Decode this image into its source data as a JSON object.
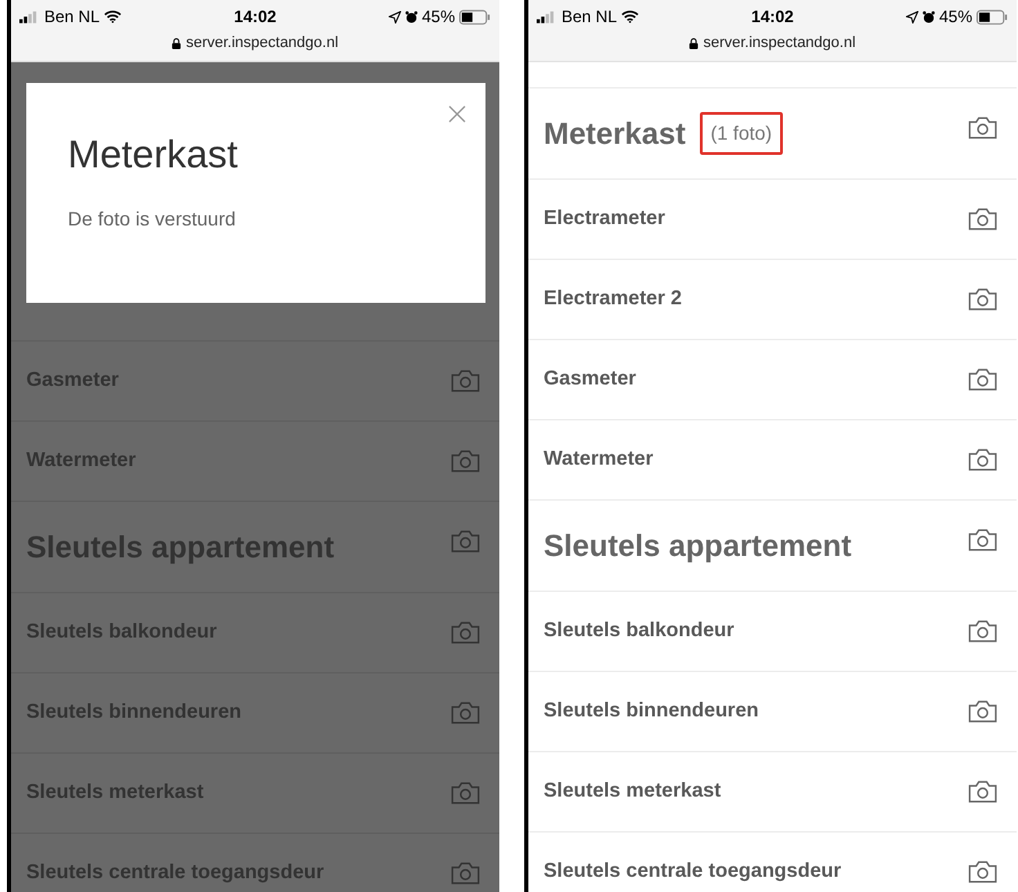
{
  "screens": [
    {
      "status_bar": {
        "carrier": "Ben NL",
        "time": "14:02",
        "battery": "45%",
        "url": "server.inspectandgo.nl"
      },
      "dimmed": true,
      "dialog": {
        "title": "Meterkast",
        "message": "De foto is verstuurd"
      },
      "items": [
        {
          "kind": "item",
          "label": "Gasmeter"
        },
        {
          "kind": "item",
          "label": "Watermeter"
        },
        {
          "kind": "heading",
          "label": "Sleutels appartement"
        },
        {
          "kind": "item",
          "label": "Sleutels balkondeur"
        },
        {
          "kind": "item",
          "label": "Sleutels binnendeuren"
        },
        {
          "kind": "item",
          "label": "Sleutels meterkast"
        },
        {
          "kind": "item",
          "label": "Sleutels centrale toegangsdeur"
        }
      ]
    },
    {
      "status_bar": {
        "carrier": "Ben NL",
        "time": "14:02",
        "battery": "45%",
        "url": "server.inspectandgo.nl"
      },
      "dimmed": false,
      "items": [
        {
          "kind": "heading",
          "label": "Meterkast",
          "count": "(1 foto)",
          "highlighted": true
        },
        {
          "kind": "item",
          "label": "Electrameter"
        },
        {
          "kind": "item",
          "label": "Electrameter 2"
        },
        {
          "kind": "item",
          "label": "Gasmeter"
        },
        {
          "kind": "item",
          "label": "Watermeter"
        },
        {
          "kind": "heading",
          "label": "Sleutels appartement"
        },
        {
          "kind": "item",
          "label": "Sleutels balkondeur"
        },
        {
          "kind": "item",
          "label": "Sleutels binnendeuren"
        },
        {
          "kind": "item",
          "label": "Sleutels meterkast"
        },
        {
          "kind": "item",
          "label": "Sleutels centrale toegangsdeur"
        }
      ]
    }
  ]
}
